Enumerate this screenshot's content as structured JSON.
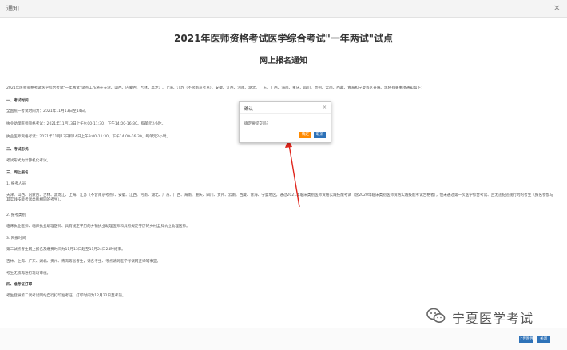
{
  "window": {
    "title": "通知"
  },
  "notice": {
    "title": "2021年医师资格考试医学综合考试\"一年两试\"试点",
    "subtitle": "网上报名通知",
    "lines": [
      "2021年医师资格考试医学综合考试\"一年两试\"试点工作将在天津、山西、内蒙古、吉林、黑龙江、上海、江苏（不含南京考点）、安徽、江西、河南、湖北、广东、广西、海南、重庆、四川、贵州、云南、西藏、青海和宁夏等区开展。现将有关事项通知如下：",
      "一、考试时间",
      "全国统一考试时间为：2021年11月13日至14日。",
      "执业助理医师资格考试：2021年11月13日上午9:00-11:30，下午14:00-16:30。每单元2小时。",
      "执业医师资格考试：2021年11月13日和14日上午9:00-11:30，下午14:00-16:30。每单元2小时。",
      "二、考试形式",
      "考试形式为计算机化考试。",
      "三、网上报名",
      "1. 报考人员",
      "天津、山西、内蒙古、吉林、黑龙江、上海、江苏（不含南京考点）、安徽、江西、河南、湖北、广东、广西、海南、重庆、四川、贵州、云南、西藏、青海、宁夏地区，通过2021年临床类别医师资格实践技能考试（含2020年临床类别医师资格实践技能考试合格者），但未通过第一次医学综合考试、且无违纪违规行为的考生（报名参加与其实践技能考试类别相同的考生）。",
      "2. 报考类别",
      "临床执业医师、临床执业助理医师、具有规定学历的乡镇执业助理医师和具有规定学历的乡村全科执业助理医师。",
      "3. 网报时间",
      "第二试点考生网上报名及缴费时间为11月13日起至11月24日24时结束。",
      "吉林、上海、广东、湖北、贵州、青海等省考生，请各考生、考点请到医学考试网查询等事宜。",
      "考生无须再进行现场审核。",
      "四、准考证打印",
      "考生登录第二试考试网站自行打印准考证，打印时间为12月22日至考前。"
    ]
  },
  "dialog": {
    "title": "确认",
    "message": "确定要提交吗？",
    "ok_label": "确定",
    "cancel_label": "取消"
  },
  "watermark": {
    "text": "宁夏医学考试"
  },
  "footer": {
    "primary_label": "上传附件",
    "secondary_label": "关闭"
  },
  "colors": {
    "ok_button": "#ff8a00",
    "cancel_button": "#2e72b8",
    "arrow": "#e0251c"
  }
}
